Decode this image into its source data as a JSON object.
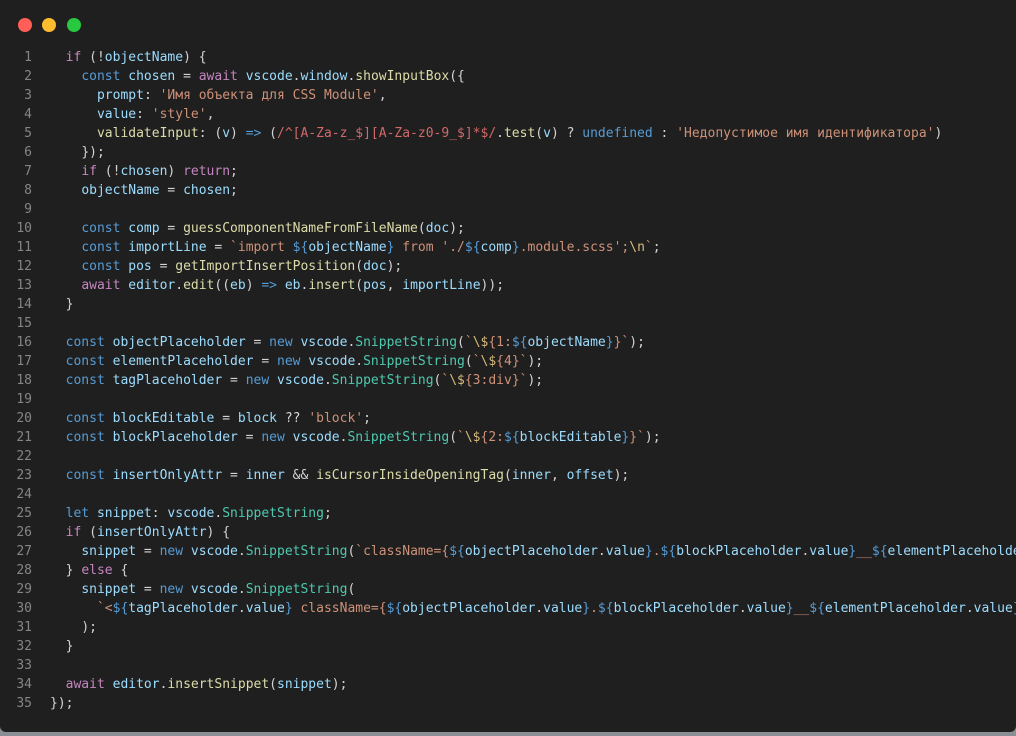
{
  "window": {
    "controls": [
      "close",
      "minimize",
      "maximize"
    ]
  },
  "editor": {
    "lines": [
      {
        "n": "1",
        "indent": "  ",
        "tokens": [
          [
            "c",
            "if"
          ],
          [
            "p",
            " (!"
          ],
          [
            "v",
            "objectName"
          ],
          [
            "p",
            ") {"
          ]
        ]
      },
      {
        "n": "2",
        "indent": "    ",
        "tokens": [
          [
            "k",
            "const "
          ],
          [
            "v",
            "chosen"
          ],
          [
            "p",
            " = "
          ],
          [
            "c",
            "await "
          ],
          [
            "v",
            "vscode"
          ],
          [
            "p",
            "."
          ],
          [
            "v",
            "window"
          ],
          [
            "p",
            "."
          ],
          [
            "f",
            "showInputBox"
          ],
          [
            "p",
            "({"
          ]
        ]
      },
      {
        "n": "3",
        "indent": "      ",
        "tokens": [
          [
            "v",
            "prompt"
          ],
          [
            "p",
            ": "
          ],
          [
            "s",
            "'Имя объекта для CSS Module'"
          ],
          [
            "p",
            ","
          ]
        ]
      },
      {
        "n": "4",
        "indent": "      ",
        "tokens": [
          [
            "v",
            "value"
          ],
          [
            "p",
            ": "
          ],
          [
            "s",
            "'style'"
          ],
          [
            "p",
            ","
          ]
        ]
      },
      {
        "n": "5",
        "indent": "      ",
        "tokens": [
          [
            "f",
            "validateInput"
          ],
          [
            "p",
            ": ("
          ],
          [
            "v",
            "v"
          ],
          [
            "p",
            ") "
          ],
          [
            "k",
            "=>"
          ],
          [
            "p",
            " ("
          ],
          [
            "r",
            "/^[A-Za-z_$][A-Za-z0-9_$]*$/"
          ],
          [
            "p",
            "."
          ],
          [
            "f",
            "test"
          ],
          [
            "p",
            "("
          ],
          [
            "v",
            "v"
          ],
          [
            "p",
            ") ? "
          ],
          [
            "k",
            "undefined"
          ],
          [
            "p",
            " : "
          ],
          [
            "s",
            "'Недопустимое имя идентификатора'"
          ],
          [
            "p",
            ")"
          ]
        ]
      },
      {
        "n": "6",
        "indent": "    ",
        "tokens": [
          [
            "p",
            "});"
          ]
        ]
      },
      {
        "n": "7",
        "indent": "    ",
        "tokens": [
          [
            "c",
            "if"
          ],
          [
            "p",
            " (!"
          ],
          [
            "v",
            "chosen"
          ],
          [
            "p",
            ") "
          ],
          [
            "c",
            "return"
          ],
          [
            "p",
            ";"
          ]
        ]
      },
      {
        "n": "8",
        "indent": "    ",
        "tokens": [
          [
            "v",
            "objectName"
          ],
          [
            "p",
            " = "
          ],
          [
            "v",
            "chosen"
          ],
          [
            "p",
            ";"
          ]
        ]
      },
      {
        "n": "9",
        "indent": "",
        "tokens": []
      },
      {
        "n": "10",
        "indent": "    ",
        "tokens": [
          [
            "k",
            "const "
          ],
          [
            "v",
            "comp"
          ],
          [
            "p",
            " = "
          ],
          [
            "f",
            "guessComponentNameFromFileName"
          ],
          [
            "p",
            "("
          ],
          [
            "v",
            "doc"
          ],
          [
            "p",
            ");"
          ]
        ]
      },
      {
        "n": "11",
        "indent": "    ",
        "tokens": [
          [
            "k",
            "const "
          ],
          [
            "v",
            "importLine"
          ],
          [
            "p",
            " = "
          ],
          [
            "s",
            "`import "
          ],
          [
            "k",
            "${"
          ],
          [
            "v",
            "objectName"
          ],
          [
            "k",
            "}"
          ],
          [
            "s",
            " from './"
          ],
          [
            "k",
            "${"
          ],
          [
            "v",
            "comp"
          ],
          [
            "k",
            "}"
          ],
          [
            "s",
            ".module.scss';"
          ],
          [
            "e",
            "\\n"
          ],
          [
            "s",
            "`"
          ],
          [
            "p",
            ";"
          ]
        ]
      },
      {
        "n": "12",
        "indent": "    ",
        "tokens": [
          [
            "k",
            "const "
          ],
          [
            "v",
            "pos"
          ],
          [
            "p",
            " = "
          ],
          [
            "f",
            "getImportInsertPosition"
          ],
          [
            "p",
            "("
          ],
          [
            "v",
            "doc"
          ],
          [
            "p",
            ");"
          ]
        ]
      },
      {
        "n": "13",
        "indent": "    ",
        "tokens": [
          [
            "c",
            "await "
          ],
          [
            "v",
            "editor"
          ],
          [
            "p",
            "."
          ],
          [
            "f",
            "edit"
          ],
          [
            "p",
            "(("
          ],
          [
            "v",
            "eb"
          ],
          [
            "p",
            ") "
          ],
          [
            "k",
            "=>"
          ],
          [
            "p",
            " "
          ],
          [
            "v",
            "eb"
          ],
          [
            "p",
            "."
          ],
          [
            "f",
            "insert"
          ],
          [
            "p",
            "("
          ],
          [
            "v",
            "pos"
          ],
          [
            "p",
            ", "
          ],
          [
            "v",
            "importLine"
          ],
          [
            "p",
            "));"
          ]
        ]
      },
      {
        "n": "14",
        "indent": "  ",
        "tokens": [
          [
            "p",
            "}"
          ]
        ]
      },
      {
        "n": "15",
        "indent": "",
        "tokens": []
      },
      {
        "n": "16",
        "indent": "  ",
        "tokens": [
          [
            "k",
            "const "
          ],
          [
            "v",
            "objectPlaceholder"
          ],
          [
            "p",
            " = "
          ],
          [
            "k",
            "new "
          ],
          [
            "v",
            "vscode"
          ],
          [
            "p",
            "."
          ],
          [
            "t",
            "SnippetString"
          ],
          [
            "p",
            "("
          ],
          [
            "s",
            "`"
          ],
          [
            "e",
            "\\$"
          ],
          [
            "s",
            "{1:"
          ],
          [
            "k",
            "${"
          ],
          [
            "v",
            "objectName"
          ],
          [
            "k",
            "}"
          ],
          [
            "s",
            "}`"
          ],
          [
            "p",
            ");"
          ]
        ]
      },
      {
        "n": "17",
        "indent": "  ",
        "tokens": [
          [
            "k",
            "const "
          ],
          [
            "v",
            "elementPlaceholder"
          ],
          [
            "p",
            " = "
          ],
          [
            "k",
            "new "
          ],
          [
            "v",
            "vscode"
          ],
          [
            "p",
            "."
          ],
          [
            "t",
            "SnippetString"
          ],
          [
            "p",
            "("
          ],
          [
            "s",
            "`"
          ],
          [
            "e",
            "\\$"
          ],
          [
            "s",
            "{4}`"
          ],
          [
            "p",
            ");"
          ]
        ]
      },
      {
        "n": "18",
        "indent": "  ",
        "tokens": [
          [
            "k",
            "const "
          ],
          [
            "v",
            "tagPlaceholder"
          ],
          [
            "p",
            " = "
          ],
          [
            "k",
            "new "
          ],
          [
            "v",
            "vscode"
          ],
          [
            "p",
            "."
          ],
          [
            "t",
            "SnippetString"
          ],
          [
            "p",
            "("
          ],
          [
            "s",
            "`"
          ],
          [
            "e",
            "\\$"
          ],
          [
            "s",
            "{3:div}`"
          ],
          [
            "p",
            ");"
          ]
        ]
      },
      {
        "n": "19",
        "indent": "",
        "tokens": []
      },
      {
        "n": "20",
        "indent": "  ",
        "tokens": [
          [
            "k",
            "const "
          ],
          [
            "v",
            "blockEditable"
          ],
          [
            "p",
            " = "
          ],
          [
            "v",
            "block"
          ],
          [
            "p",
            " ?? "
          ],
          [
            "s",
            "'block'"
          ],
          [
            "p",
            ";"
          ]
        ]
      },
      {
        "n": "21",
        "indent": "  ",
        "tokens": [
          [
            "k",
            "const "
          ],
          [
            "v",
            "blockPlaceholder"
          ],
          [
            "p",
            " = "
          ],
          [
            "k",
            "new "
          ],
          [
            "v",
            "vscode"
          ],
          [
            "p",
            "."
          ],
          [
            "t",
            "SnippetString"
          ],
          [
            "p",
            "("
          ],
          [
            "s",
            "`"
          ],
          [
            "e",
            "\\$"
          ],
          [
            "s",
            "{2:"
          ],
          [
            "k",
            "${"
          ],
          [
            "v",
            "blockEditable"
          ],
          [
            "k",
            "}"
          ],
          [
            "s",
            "}`"
          ],
          [
            "p",
            ");"
          ]
        ]
      },
      {
        "n": "22",
        "indent": "",
        "tokens": []
      },
      {
        "n": "23",
        "indent": "  ",
        "tokens": [
          [
            "k",
            "const "
          ],
          [
            "v",
            "insertOnlyAttr"
          ],
          [
            "p",
            " = "
          ],
          [
            "v",
            "inner"
          ],
          [
            "p",
            " && "
          ],
          [
            "f",
            "isCursorInsideOpeningTag"
          ],
          [
            "p",
            "("
          ],
          [
            "v",
            "inner"
          ],
          [
            "p",
            ", "
          ],
          [
            "v",
            "offset"
          ],
          [
            "p",
            ");"
          ]
        ]
      },
      {
        "n": "24",
        "indent": "",
        "tokens": []
      },
      {
        "n": "25",
        "indent": "  ",
        "tokens": [
          [
            "k",
            "let "
          ],
          [
            "v",
            "snippet"
          ],
          [
            "p",
            ": "
          ],
          [
            "v",
            "vscode"
          ],
          [
            "p",
            "."
          ],
          [
            "t",
            "SnippetString"
          ],
          [
            "p",
            ";"
          ]
        ]
      },
      {
        "n": "26",
        "indent": "  ",
        "tokens": [
          [
            "c",
            "if"
          ],
          [
            "p",
            " ("
          ],
          [
            "v",
            "insertOnlyAttr"
          ],
          [
            "p",
            ") {"
          ]
        ]
      },
      {
        "n": "27",
        "indent": "    ",
        "tokens": [
          [
            "v",
            "snippet"
          ],
          [
            "p",
            " = "
          ],
          [
            "k",
            "new "
          ],
          [
            "v",
            "vscode"
          ],
          [
            "p",
            "."
          ],
          [
            "t",
            "SnippetString"
          ],
          [
            "p",
            "("
          ],
          [
            "s",
            "`className={"
          ],
          [
            "k",
            "${"
          ],
          [
            "v",
            "objectPlaceholder"
          ],
          [
            "p",
            "."
          ],
          [
            "v",
            "value"
          ],
          [
            "k",
            "}"
          ],
          [
            "s",
            "."
          ],
          [
            "k",
            "${"
          ],
          [
            "v",
            "blockPlaceholder"
          ],
          [
            "p",
            "."
          ],
          [
            "v",
            "value"
          ],
          [
            "k",
            "}"
          ],
          [
            "s",
            "__"
          ],
          [
            "k",
            "${"
          ],
          [
            "v",
            "elementPlaceholder"
          ],
          [
            "p",
            "."
          ]
        ]
      },
      {
        "n": "28",
        "indent": "  ",
        "tokens": [
          [
            "p",
            "} "
          ],
          [
            "c",
            "else"
          ],
          [
            "p",
            " {"
          ]
        ]
      },
      {
        "n": "29",
        "indent": "    ",
        "tokens": [
          [
            "v",
            "snippet"
          ],
          [
            "p",
            " = "
          ],
          [
            "k",
            "new "
          ],
          [
            "v",
            "vscode"
          ],
          [
            "p",
            "."
          ],
          [
            "t",
            "SnippetString"
          ],
          [
            "p",
            "("
          ]
        ]
      },
      {
        "n": "30",
        "indent": "      ",
        "tokens": [
          [
            "s",
            "`<"
          ],
          [
            "k",
            "${"
          ],
          [
            "v",
            "tagPlaceholder"
          ],
          [
            "p",
            "."
          ],
          [
            "v",
            "value"
          ],
          [
            "k",
            "}"
          ],
          [
            "s",
            " className={"
          ],
          [
            "k",
            "${"
          ],
          [
            "v",
            "objectPlaceholder"
          ],
          [
            "p",
            "."
          ],
          [
            "v",
            "value"
          ],
          [
            "k",
            "}"
          ],
          [
            "s",
            "."
          ],
          [
            "k",
            "${"
          ],
          [
            "v",
            "blockPlaceholder"
          ],
          [
            "p",
            "."
          ],
          [
            "v",
            "value"
          ],
          [
            "k",
            "}"
          ],
          [
            "s",
            "__"
          ],
          [
            "k",
            "${"
          ],
          [
            "v",
            "elementPlaceholder"
          ],
          [
            "p",
            "."
          ],
          [
            "v",
            "value"
          ],
          [
            "k",
            "}"
          ],
          [
            "s",
            "}>"
          ]
        ]
      },
      {
        "n": "31",
        "indent": "    ",
        "tokens": [
          [
            "p",
            ");"
          ]
        ]
      },
      {
        "n": "32",
        "indent": "  ",
        "tokens": [
          [
            "p",
            "}"
          ]
        ]
      },
      {
        "n": "33",
        "indent": "",
        "tokens": []
      },
      {
        "n": "34",
        "indent": "  ",
        "tokens": [
          [
            "c",
            "await "
          ],
          [
            "v",
            "editor"
          ],
          [
            "p",
            "."
          ],
          [
            "f",
            "insertSnippet"
          ],
          [
            "p",
            "("
          ],
          [
            "v",
            "snippet"
          ],
          [
            "p",
            ");"
          ]
        ]
      },
      {
        "n": "35",
        "indent": "",
        "tokens": [
          [
            "p",
            "});"
          ]
        ]
      }
    ]
  },
  "colors": {
    "background": "#1f1f1f",
    "line_numbers": "#858585",
    "keyword": "#569cd6",
    "control": "#c586c0",
    "variable": "#9cdcfe",
    "function": "#dcdcaa",
    "type": "#4ec9b0",
    "string": "#ce9178"
  }
}
